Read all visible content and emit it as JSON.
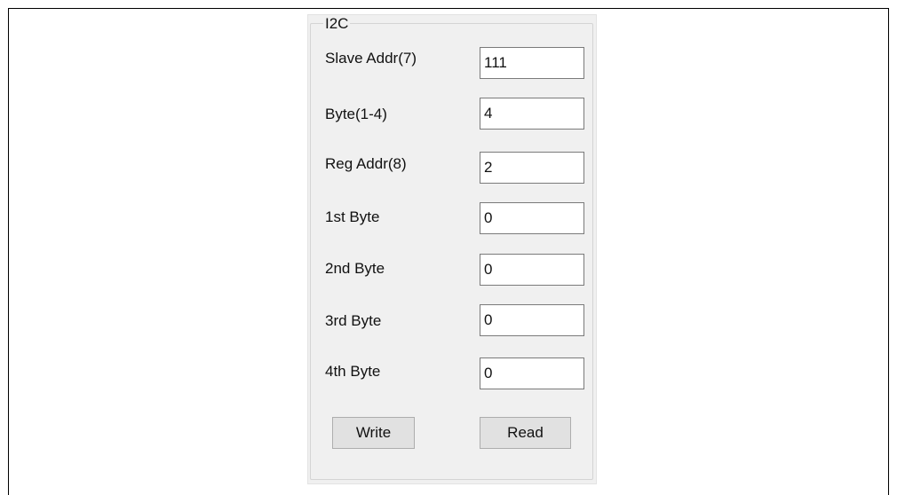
{
  "groupbox": {
    "title": "I2C"
  },
  "fields": [
    {
      "label": "Slave Addr(7)",
      "value": "111"
    },
    {
      "label": "Byte(1-4)",
      "value": "4"
    },
    {
      "label": "Reg Addr(8)",
      "value": "2"
    },
    {
      "label": "1st Byte",
      "value": "0"
    },
    {
      "label": "2nd Byte",
      "value": "0"
    },
    {
      "label": "3rd Byte",
      "value": "0"
    },
    {
      "label": "4th Byte",
      "value": "0"
    }
  ],
  "buttons": {
    "write_label": "Write",
    "read_label": "Read"
  }
}
